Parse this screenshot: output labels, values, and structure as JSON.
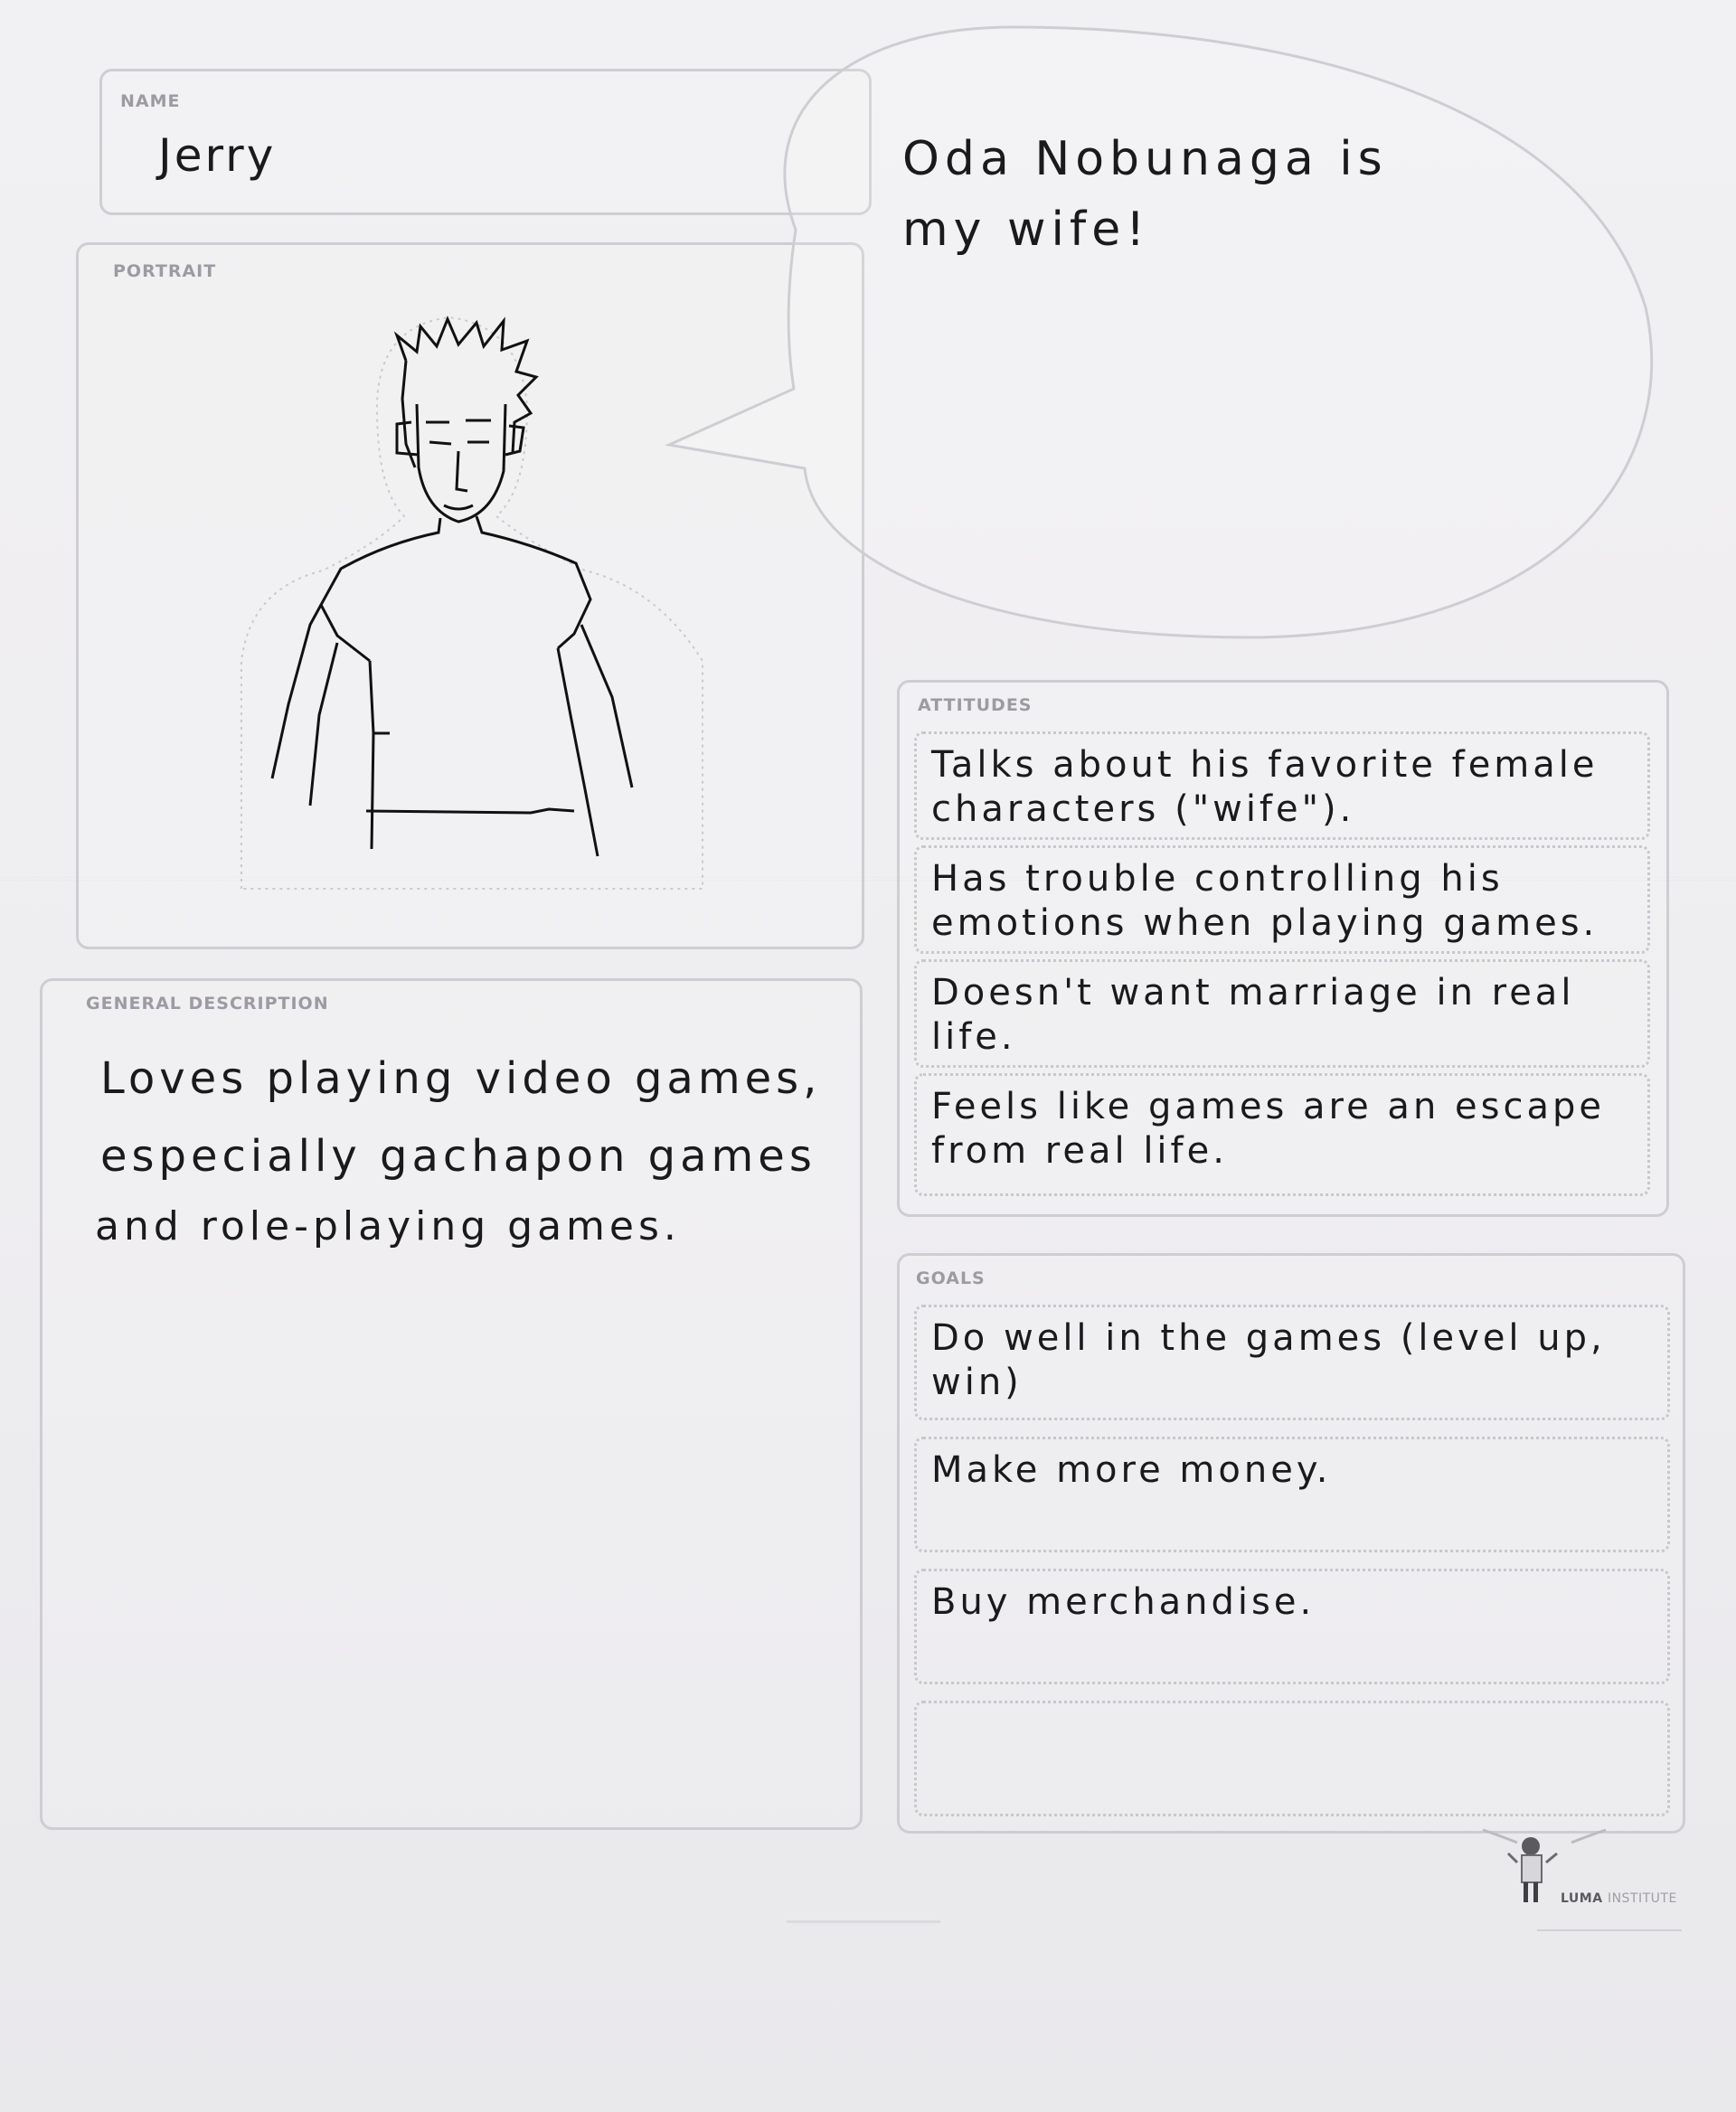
{
  "name": {
    "label": "NAME",
    "value": "Jerry"
  },
  "portrait": {
    "label": "PORTRAIT"
  },
  "quote": {
    "line1": "Oda Nobunaga is",
    "line2": "my wife!"
  },
  "description": {
    "label": "GENERAL DESCRIPTION",
    "lines": [
      "Loves playing video games,",
      "especially gachapon games",
      "and role-playing games."
    ]
  },
  "attitudes": {
    "label": "ATTITUDES",
    "items": [
      "Talks about his favorite female characters (\"wife\").",
      "Has trouble controlling his emotions when playing games.",
      "Doesn't want marriage in real life.",
      "Feels like games are an escape from real life."
    ]
  },
  "goals": {
    "label": "GOALS",
    "items": [
      "Do well in the games (level up, win)",
      "Make more money.",
      "Buy merchandise.",
      ""
    ]
  },
  "footer": {
    "brand_bold": "LUMA",
    "brand_light": "INSTITUTE"
  },
  "colors": {
    "paper": "#efeef1",
    "frame": "#cfcdd2",
    "ink": "#1a1a1c",
    "label": "#9d9ba1"
  }
}
